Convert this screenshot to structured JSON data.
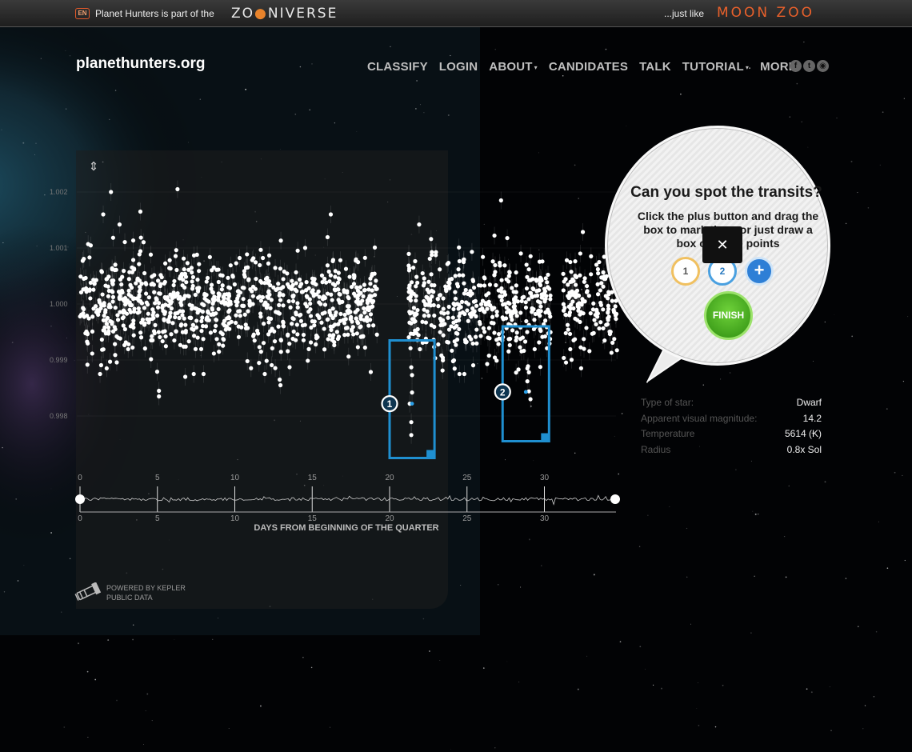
{
  "topbar": {
    "lang": "EN",
    "part_of": "Planet Hunters is part of the",
    "zooniverse_a": "ZO",
    "zooniverse_b": "NIVERSE",
    "just_like": "...just like",
    "moon_zoo": "MOON ZOO"
  },
  "header": {
    "site_title": "planethunters.org",
    "nav": [
      {
        "label": "CLASSIFY",
        "dropdown": false
      },
      {
        "label": "LOGIN",
        "dropdown": false
      },
      {
        "label": "ABOUT",
        "dropdown": true
      },
      {
        "label": "CANDIDATES",
        "dropdown": false
      },
      {
        "label": "TALK",
        "dropdown": false
      },
      {
        "label": "TUTORIAL",
        "dropdown": true
      },
      {
        "label": "MORE",
        "dropdown": true
      }
    ],
    "social": [
      "f",
      "t",
      "rss"
    ],
    "caret": "▾"
  },
  "chart_data": {
    "type": "scatter",
    "xlabel": "DAYS FROM BEGINNING OF THE QUARTER",
    "ylabel": "",
    "xlim": [
      0,
      35
    ],
    "ylim": [
      0.9975,
      1.0022
    ],
    "x_ticks": [
      "0",
      "5",
      "10",
      "15",
      "20",
      "25",
      "30"
    ],
    "y_ticks": [
      "0.998",
      "0.999",
      "1.000",
      "1.001",
      "1.002"
    ],
    "segments": [
      [
        0,
        19.2
      ],
      [
        21.2,
        30.4
      ],
      [
        31.2,
        35
      ]
    ],
    "baseline": 1.0,
    "scatter_sd": 0.00045,
    "transit_points": [
      {
        "x": 21.4,
        "y": 0.99887
      },
      {
        "x": 21.35,
        "y": 0.99921
      },
      {
        "x": 21.45,
        "y": 0.99873
      },
      {
        "x": 21.3,
        "y": 0.99822
      },
      {
        "x": 21.4,
        "y": 0.99789
      },
      {
        "x": 21.4,
        "y": 0.99766
      },
      {
        "x": 21.45,
        "y": 0.99842
      },
      {
        "x": 28.9,
        "y": 0.99862
      },
      {
        "x": 29.0,
        "y": 0.99844
      },
      {
        "x": 29.1,
        "y": 0.9983
      },
      {
        "x": 28.9,
        "y": 0.99885
      },
      {
        "x": 28.6,
        "y": 0.9994
      },
      {
        "x": 29.0,
        "y": 0.99878
      }
    ],
    "outliers": [
      {
        "x": 2.0,
        "y": 1.002
      },
      {
        "x": 6.3,
        "y": 1.00205
      },
      {
        "x": 27.2,
        "y": 1.00185
      },
      {
        "x": 1.5,
        "y": 1.0016
      },
      {
        "x": 3.9,
        "y": 1.00165
      },
      {
        "x": 16.2,
        "y": 1.0016
      },
      {
        "x": 5.1,
        "y": 0.99845
      },
      {
        "x": 5.1,
        "y": 0.99835
      },
      {
        "x": 12.9,
        "y": 0.99865
      },
      {
        "x": 12.95,
        "y": 0.99855
      },
      {
        "x": 6.8,
        "y": 0.9987
      }
    ],
    "marks": [
      {
        "label": "1",
        "x_start": 20.0,
        "x_end": 22.9,
        "y_top": 0.99935,
        "y_bottom": 0.99725,
        "dot_y": 0.99822
      },
      {
        "label": "2",
        "x_start": 27.3,
        "x_end": 30.3,
        "y_top": 0.9996,
        "y_bottom": 0.99755,
        "dot_y": 0.99843
      }
    ],
    "colors": {
      "points": "#ffffff",
      "mark": "#1f8fd0",
      "axis": "#aaaaaa"
    }
  },
  "bubble": {
    "title": "Can you spot the transits?",
    "text": "Click the plus button and drag the box to mark them or just draw a box over the points",
    "close": "✕",
    "mark_1": "1",
    "mark_2": "2",
    "add": "+",
    "finish": "FINISH"
  },
  "star": [
    {
      "label": "Type of star:",
      "value": "Dwarf"
    },
    {
      "label": "Apparent visual magnitude:",
      "value": "14.2"
    },
    {
      "label": "Temperature",
      "value": "5614 (K)"
    },
    {
      "label": "Radius",
      "value": "0.8x Sol"
    }
  ],
  "footer": {
    "kepler_line1": "POWERED BY KEPLER",
    "kepler_line2": "PUBLIC DATA"
  },
  "icons": {
    "fit": "⇕",
    "kepler": "telescope-icon"
  }
}
